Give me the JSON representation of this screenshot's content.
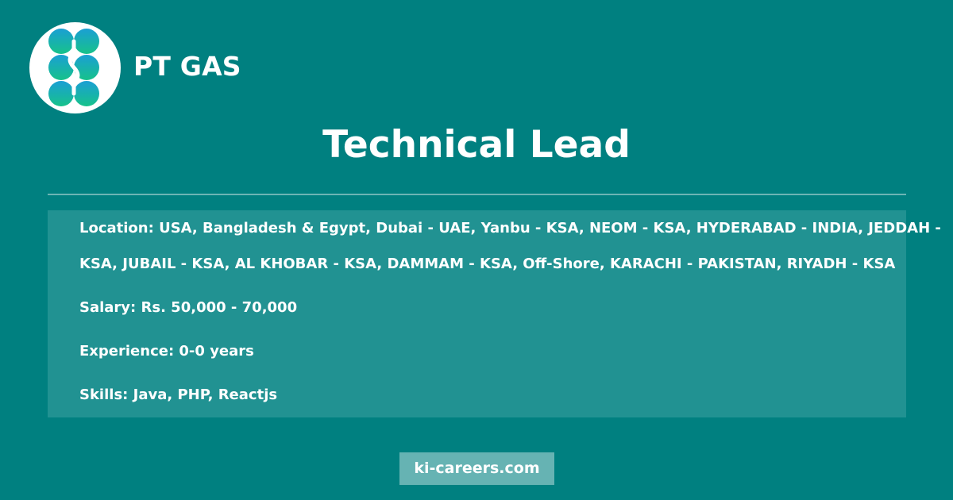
{
  "header": {
    "company_name": "PT GAS",
    "logo_icon": "company-logo-icon",
    "logo_colors": [
      "#1a9fd4",
      "#17c28a",
      "#0eb0b0"
    ]
  },
  "job": {
    "title": "Technical Lead"
  },
  "details": {
    "location_line_1": "Location: USA, Bangladesh & Egypt, Dubai - UAE, Yanbu - KSA, NEOM - KSA, HYDERABAD - INDIA, JEDDAH -",
    "location_line_2": "KSA, JUBAIL - KSA, AL KHOBAR - KSA, DAMMAM - KSA, Off-Shore, KARACHI - PAKISTAN, RIYADH - KSA",
    "salary": "Salary: Rs. 50,000 - 70,000",
    "experience": "Experience: 0-0 years",
    "skills": "Skills: Java, PHP, Reactjs"
  },
  "footer": {
    "site": "ki-careers.com"
  },
  "colors": {
    "background": "#008080",
    "panel": "#219292",
    "divider": "#6db5b5",
    "footer_badge": "#66b3b3"
  }
}
